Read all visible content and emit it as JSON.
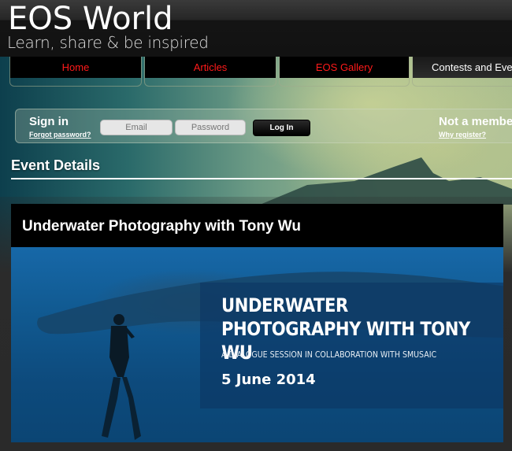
{
  "header": {
    "logo_title": "EOS World",
    "logo_tagline": "Learn, share & be inspired"
  },
  "nav": {
    "items": [
      {
        "label": "Home"
      },
      {
        "label": "Articles"
      },
      {
        "label": "EOS Gallery"
      },
      {
        "label": "Contests and Eve"
      }
    ],
    "active_color": "#ffffff",
    "link_color": "#ff1a1a"
  },
  "signin": {
    "title": "Sign in",
    "forgot_link": "Forgot password?",
    "email_placeholder": "Email",
    "password_placeholder": "Password",
    "login_button": "Log In",
    "not_member": "Not a member",
    "why_register": "Why register?"
  },
  "event": {
    "section_title": "Event Details",
    "title": "Underwater Photography with Tony Wu",
    "banner": {
      "headline": "UNDERWATER PHOTOGRAPHY WITH TONY WU",
      "subtitle": "A DIALOGUE SESSION IN COLLABORATION WITH SMUSAIC",
      "date": "5 June 2014"
    }
  }
}
